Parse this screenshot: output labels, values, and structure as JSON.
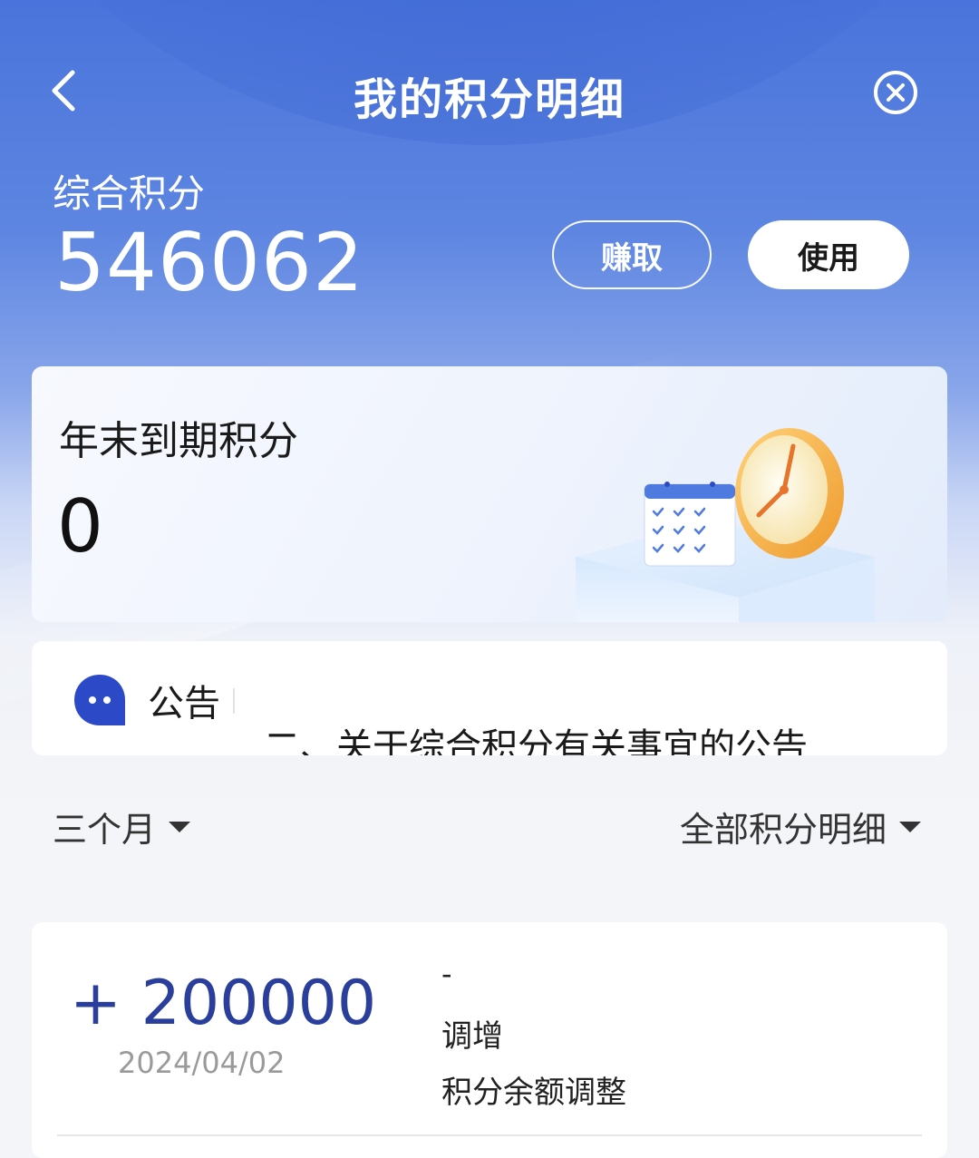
{
  "header": {
    "title": "我的积分明细",
    "back_icon": "chevron-left-icon",
    "close_icon": "close-circle-icon"
  },
  "summary": {
    "label": "综合积分",
    "value": "546062",
    "earn_label": "赚取",
    "use_label": "使用"
  },
  "expiry": {
    "label": "年末到期积分",
    "value": "0",
    "illustration": "calendar-clock-illustration"
  },
  "notice": {
    "label": "公告",
    "text": "二、关于综合积分有关事宜的公告",
    "icon": "chat-bubble-icon"
  },
  "filters": {
    "period": "三个月",
    "type": "全部积分明细"
  },
  "records": [
    {
      "amount": "+ 200000",
      "date": "2024/04/02",
      "dash": "-",
      "type": "调增",
      "desc": "积分余额调整"
    }
  ],
  "colors": {
    "header_blue": "#4a74db",
    "amount_blue": "#2a3e9c",
    "notice_icon_blue": "#2c49c7",
    "clock_orange": "#f0a93a"
  }
}
